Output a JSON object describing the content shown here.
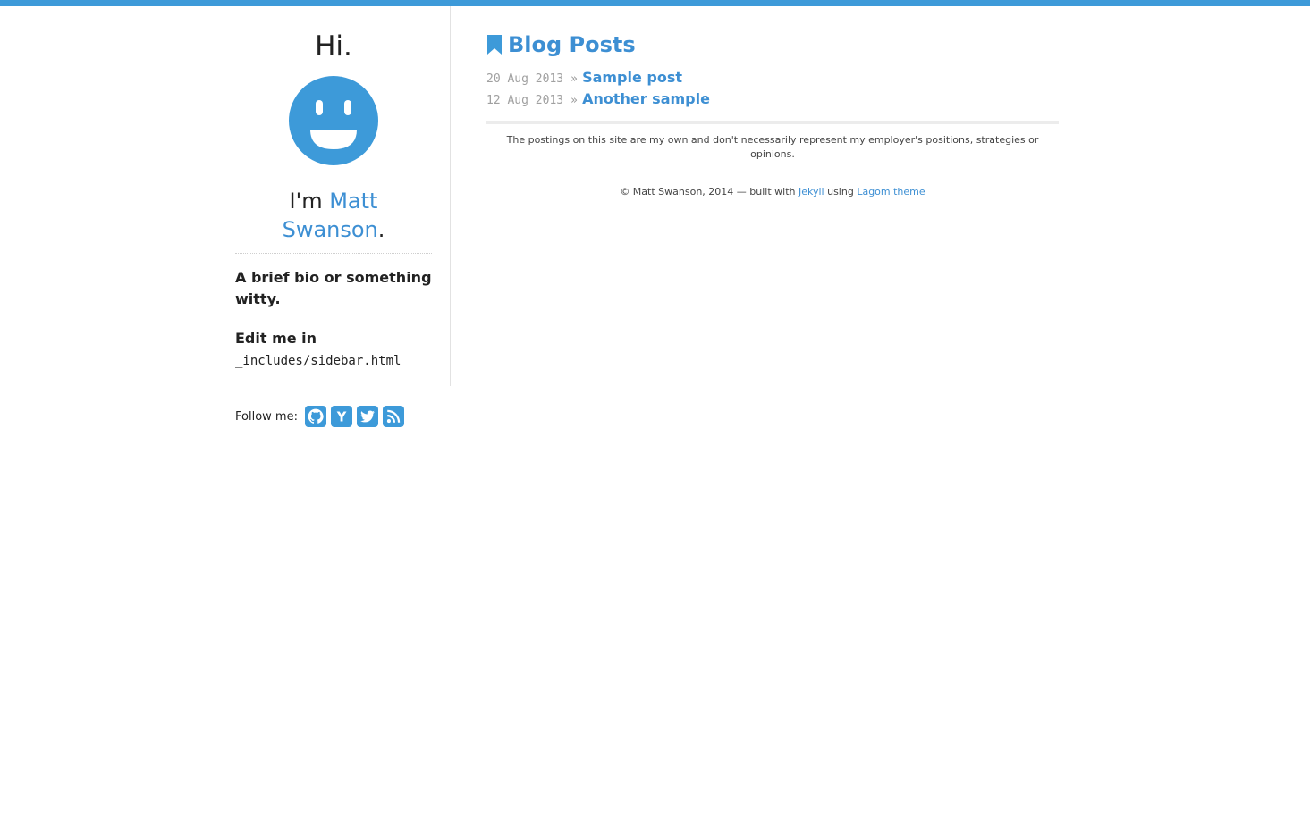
{
  "colors": {
    "accent": "#3d9ad9",
    "link": "#3d8fd3"
  },
  "sidebar": {
    "greeting": "Hi.",
    "avatar_icon": "smiley-face-icon",
    "im_prefix": "I'm ",
    "name": "Matt Swanson",
    "im_suffix": ".",
    "bio": "A brief bio or something witty.",
    "edit_prefix": "Edit me in",
    "edit_path": "_includes/sidebar.html",
    "follow_label": "Follow me:",
    "social": [
      {
        "icon": "github-icon"
      },
      {
        "icon": "hacker-news-icon",
        "letter": "Y"
      },
      {
        "icon": "twitter-icon"
      },
      {
        "icon": "rss-icon"
      }
    ]
  },
  "main": {
    "title": "Blog Posts",
    "title_icon": "bookmark-icon",
    "posts": [
      {
        "date": "20 Aug 2013",
        "sep": "»",
        "title": "Sample post"
      },
      {
        "date": "12 Aug 2013",
        "sep": "»",
        "title": "Another sample"
      }
    ],
    "disclaimer": "The postings on this site are my own and don't necessarily represent my employer's positions, strategies or opinions.",
    "footer": {
      "prefix": "© Matt Swanson, 2014 — built with ",
      "jekyll": "Jekyll",
      "middle": " using ",
      "theme": "Lagom theme"
    }
  }
}
